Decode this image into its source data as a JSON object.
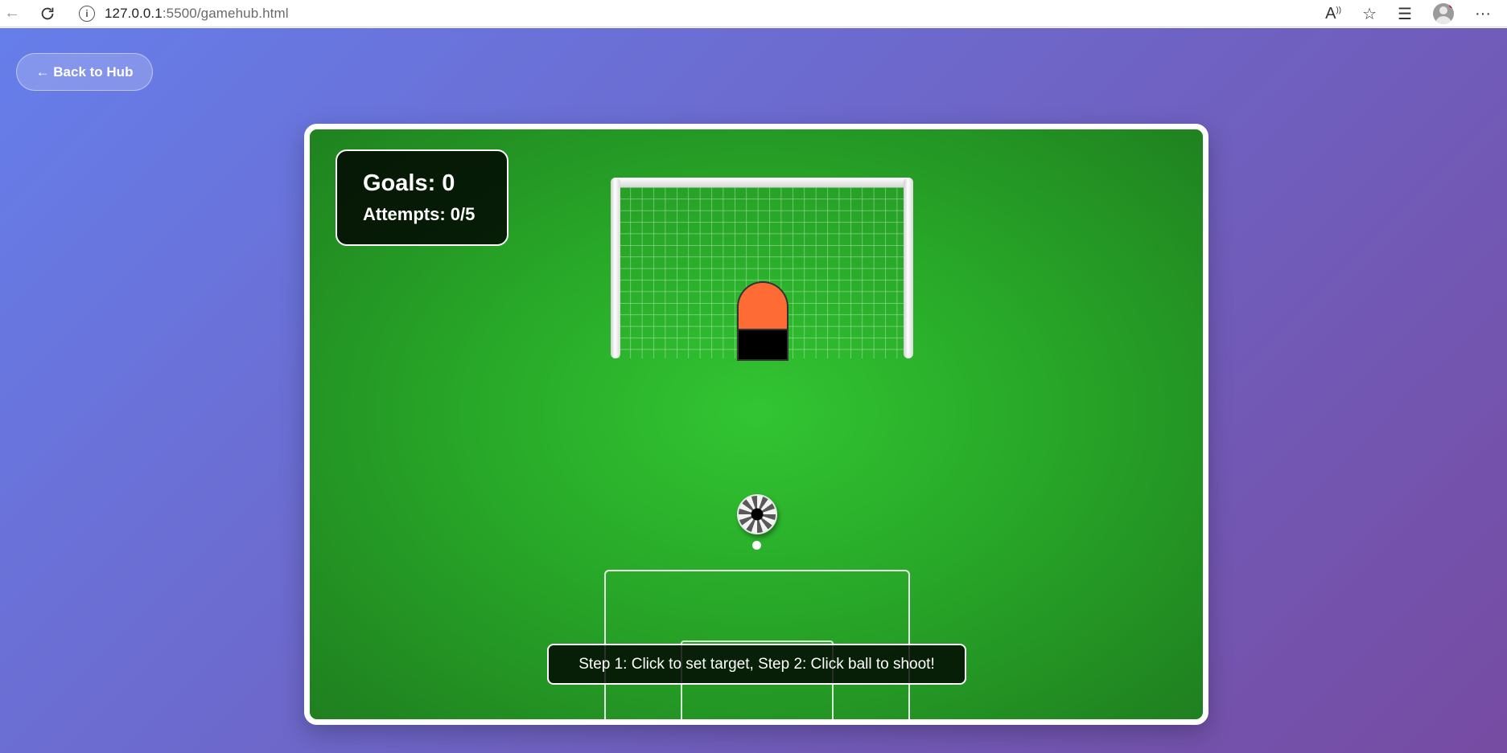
{
  "browser": {
    "url_host": "127.0.0.1",
    "url_rest": ":5500/gamehub.html",
    "icons": [
      "back-arrow-icon",
      "reload-icon",
      "info-icon",
      "read-aloud-icon",
      "favorite-star-icon",
      "favorites-icon",
      "profile-avatar-icon",
      "more-menu-icon"
    ]
  },
  "page": {
    "back_label": "← Back to Hub"
  },
  "game": {
    "goals_label": "Goals: 0",
    "attempts_label": "Attempts: 0/5",
    "instruction": "Step 1: Click to set target, Step 2: Click ball to shoot!",
    "goals": 0,
    "attempts": 0,
    "max_attempts": 5
  },
  "colors": {
    "background_gradient": [
      "#667eea",
      "#764ba2"
    ],
    "pitch": "#28a828",
    "keeper_shirt": "#ff6b35",
    "keeper_shorts": "#000000"
  }
}
